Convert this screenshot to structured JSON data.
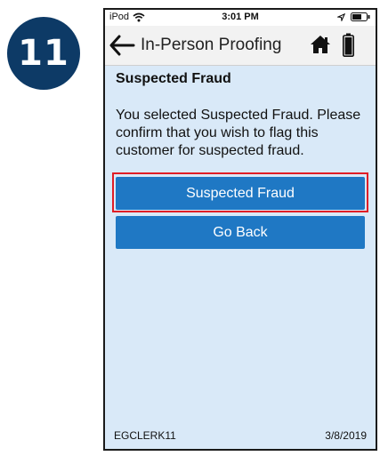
{
  "step_number": "11",
  "status_bar": {
    "device": "iPod",
    "time": "3:01 PM",
    "icons": [
      "wifi-icon",
      "location-icon",
      "battery-icon"
    ]
  },
  "nav": {
    "title": "In-Person Proofing",
    "icons": [
      "back-arrow-icon",
      "home-icon",
      "device-battery-icon"
    ]
  },
  "screen": {
    "heading": "Suspected Fraud",
    "message": "You selected Suspected Fraud. Please confirm that you wish to flag this customer for suspected fraud.",
    "buttons": {
      "confirm_label": "Suspected Fraud",
      "back_label": "Go Back"
    },
    "highlight_color": "#e01e26",
    "button_color": "#1f78c4"
  },
  "footer": {
    "user": "EGCLERK11",
    "date": "3/8/2019"
  }
}
